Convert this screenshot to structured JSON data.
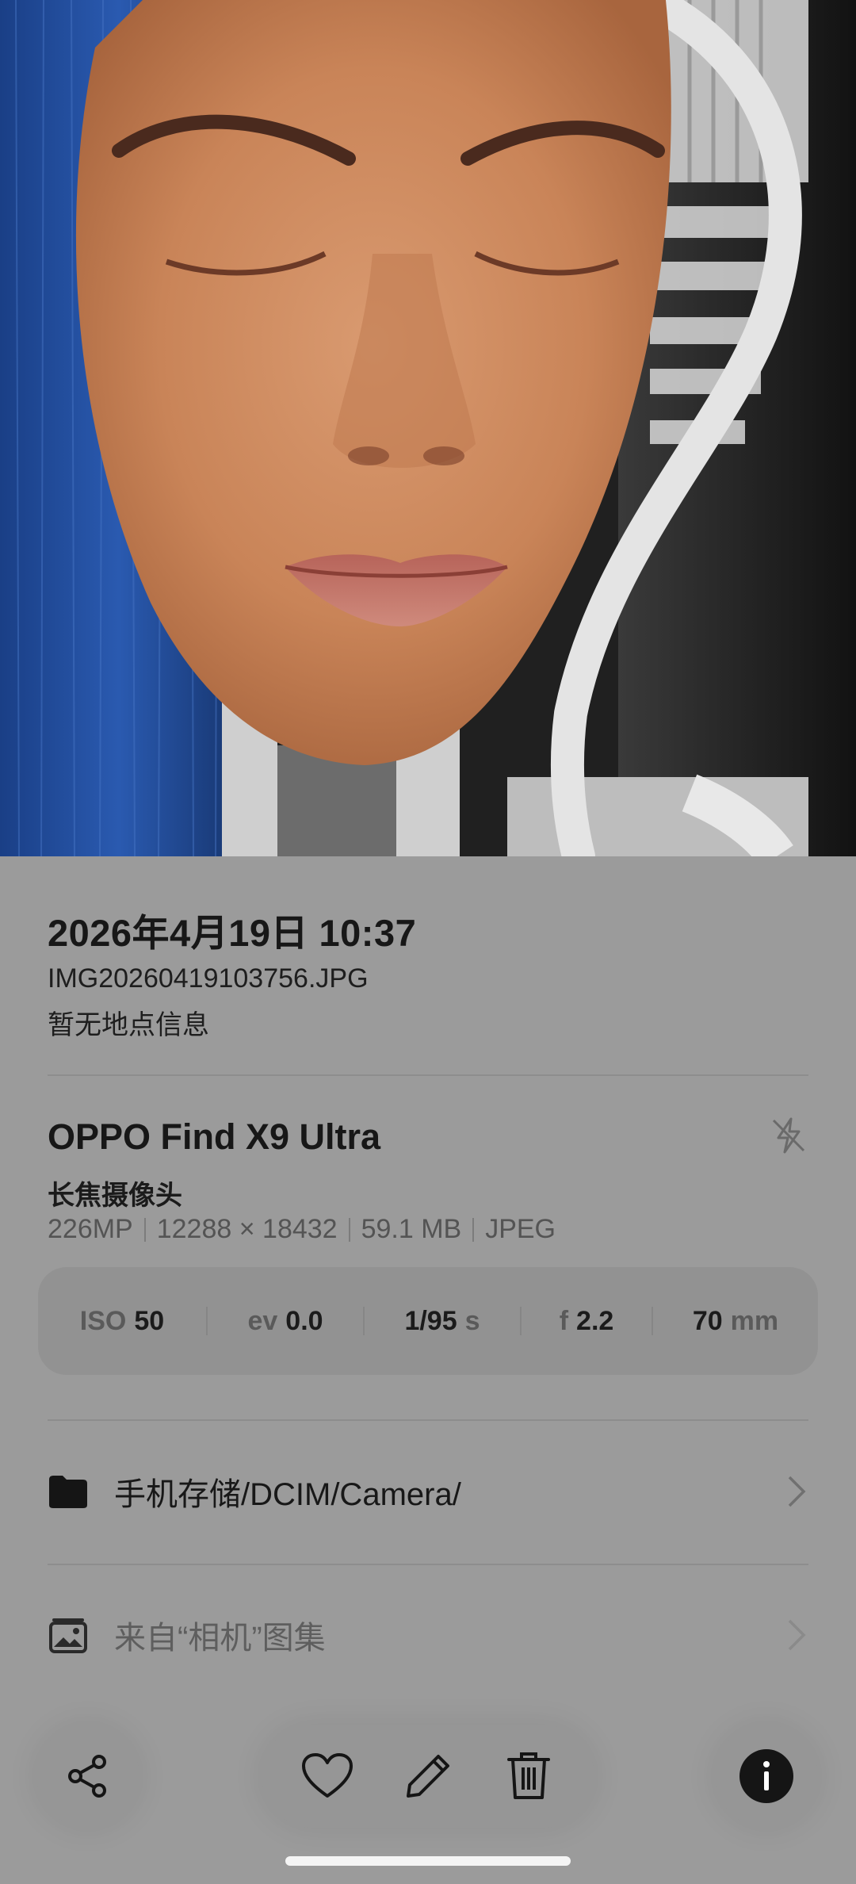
{
  "photo": {
    "description_icon": "photo-preview"
  },
  "info": {
    "date": "2026年4月19日 10:37",
    "filename": "IMG20260419103756.JPG",
    "location": "暂无地点信息"
  },
  "device": {
    "name": "OPPO Find X9 Ultra",
    "camera": "长焦摄像头",
    "megapixels": "226MP",
    "resolution": "12288 × 18432",
    "size": "59.1 MB",
    "format": "JPEG",
    "flash_icon": "flash-off-icon"
  },
  "exif": {
    "iso_label": "ISO",
    "iso_value": "50",
    "ev_label": "ev",
    "ev_value": "0.0",
    "shutter_value": "1/95",
    "shutter_unit": "s",
    "aperture_label": "f",
    "aperture_value": "2.2",
    "focal_value": "70",
    "focal_unit": "mm"
  },
  "rows": {
    "storage_path": "手机存储/DCIM/Camera/",
    "album": "来自“相机”图集"
  },
  "toolbar": {
    "share_icon": "share-icon",
    "favorite_icon": "heart-icon",
    "edit_icon": "pencil-icon",
    "delete_icon": "trash-icon",
    "info_icon": "info-icon"
  },
  "colors": {
    "panel_bg": "#9b9b9b",
    "exif_bg": "#929292",
    "info_btn": "#151515"
  }
}
